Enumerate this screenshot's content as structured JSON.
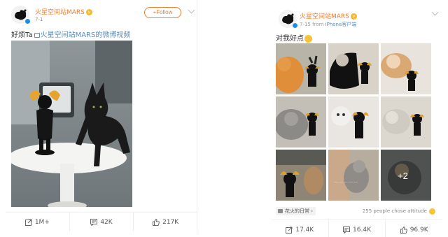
{
  "left_post": {
    "user_name": "火星空间站MARS",
    "vip_icon": "vip-badge-icon",
    "date": "7-1",
    "follow_label": "+Follow",
    "text_prefix": "好烦Ta",
    "link_text": "火星空间站MARS的微博视频",
    "actions": {
      "repost": "1M+",
      "comment": "42K",
      "like": "217K"
    }
  },
  "right_post": {
    "user_name": "火星空间站MARS",
    "date": "7-15",
    "source_prefix": "from",
    "source": "iPhone客户端",
    "text": "对我好点",
    "more_count": "+2",
    "overlay_caption": "……………",
    "topic": "花火的日常",
    "attitude": "255 people chose attitude",
    "actions": {
      "repost": "17.4K",
      "comment": "16.4K",
      "like": "96.9K"
    }
  },
  "colors": {
    "brand_orange": "#f27b28",
    "link_blue": "#5b8dbd",
    "verified_blue": "#1d8cf0"
  }
}
